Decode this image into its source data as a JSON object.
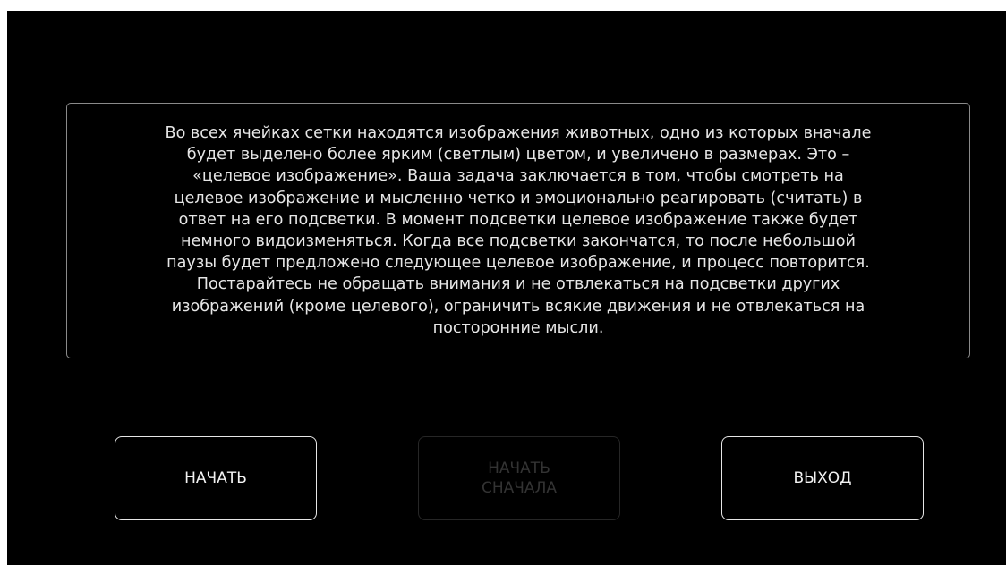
{
  "instructions": {
    "text": "Во всех ячейках сетки находятся изображения животных, одно из которых вначале\nбудет выделено более ярким (светлым) цветом, и увеличено в размерах. Это –\n«целевое изображение». Ваша задача заключается в том, чтобы смотреть на\nцелевое изображение и мысленно четко и эмоционально реагировать (считать) в\nответ на его подсветки. В момент подсветки целевое изображение также будет\nнемного видоизменяться. Когда все подсветки закончатся, то после небольшой\nпаузы будет предложено следующее целевое изображение, и процесс повторится.\nПостарайтесь не обращать внимания и не отвлекаться на подсветки других\nизображений (кроме целевого), ограничить всякие движения и не отвлекаться на\nпосторонние мысли."
  },
  "buttons": {
    "start_label": "НАЧАТЬ",
    "restart_label": "НАЧАТЬ\nСНАЧАЛА",
    "restart_enabled": false,
    "exit_label": "ВЫХОД"
  },
  "colors": {
    "background": "#000000",
    "text": "#e6e6e6",
    "border": "#8a8a8a",
    "disabled": "#333333"
  }
}
